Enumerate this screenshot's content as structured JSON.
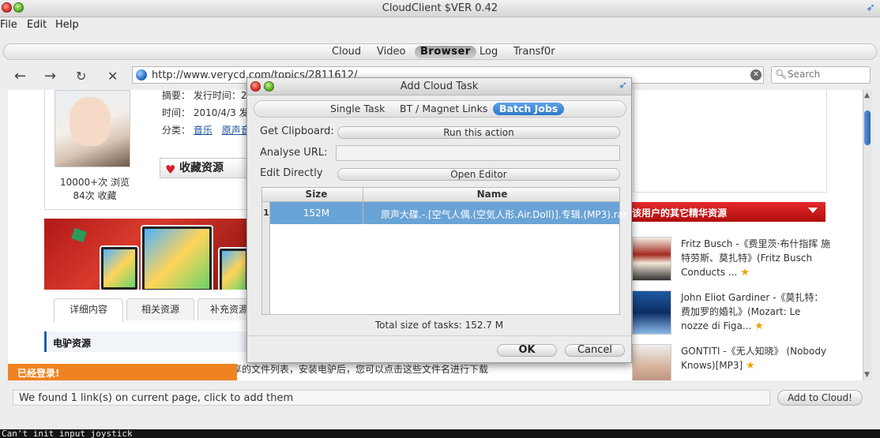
{
  "window": {
    "title": "CloudClient $VER 0.42"
  },
  "menu": [
    "File",
    "Edit",
    "Help"
  ],
  "main_tabs": [
    "Cloud",
    "Video",
    "Browser",
    "Log",
    "Transf0r"
  ],
  "browser": {
    "url": "http://www.verycd.com/topics/2811612/",
    "search_placeholder": "Search"
  },
  "page": {
    "meta_summary": "摘要：  发行时间：2",
    "meta_time": "时间：  2010/4/3 发",
    "meta_category_label": "分类：",
    "meta_category_1": "音乐",
    "meta_category_2": "原声音",
    "views": "10000+次 浏览",
    "favorites": "84次 收藏",
    "collect_button": "收藏资源",
    "tabs": [
      "详细内容",
      "相关资源",
      "补充资源"
    ],
    "section_title": "电驴资源",
    "description": "下面是用户共享的文件列表，安装电驴后，您可以点击这些文件名进行下载",
    "login_status": "已经登录!",
    "featured_header": "该用户的其它精华资源",
    "featured": [
      {
        "text": "Fritz Busch -《费里茨·布什指挥 施特劳斯、莫扎特》(Fritz Busch Conducts ..."
      },
      {
        "text": "John Eliot Gardiner -《莫扎特：费加罗的婚礼》(Mozart: Le nozze di Figa..."
      },
      {
        "text": "GONTITI -《无人知晓》 (Nobody Knows)[MP3]"
      }
    ]
  },
  "status": {
    "found_links": "We found 1 link(s) on current page, click to add them",
    "add_to_cloud": "Add to Cloud!"
  },
  "terminal": {
    "line": "Can't init input joystick"
  },
  "dialog": {
    "title": "Add Cloud Task",
    "tabs": [
      "Single Task",
      "BT / Magnet Links",
      "Batch Jobs"
    ],
    "active_tab": "Batch Jobs",
    "get_clipboard_label": "Get Clipboard:",
    "get_clipboard_button": "Run this action",
    "analyse_url_label": "Analyse URL:",
    "analyse_url_value": "",
    "edit_directly_label": "Edit Directly",
    "open_editor_button": "Open Editor",
    "table": {
      "columns": [
        "Size",
        "Name"
      ],
      "rows": [
        {
          "num": "1",
          "size": "152M",
          "name": "原声大碟.-.[空气人偶.(空気人形.Air.Doll)].专辑.(MP3).rar"
        }
      ]
    },
    "total": "Total size of tasks: 152.7 M",
    "ok": "OK",
    "cancel": "Cancel"
  },
  "colors": {
    "accent_blue": "#2e77c7",
    "selected_row": "#6aa3d6",
    "featured_red": "#c41414",
    "login_orange": "#f08321"
  }
}
